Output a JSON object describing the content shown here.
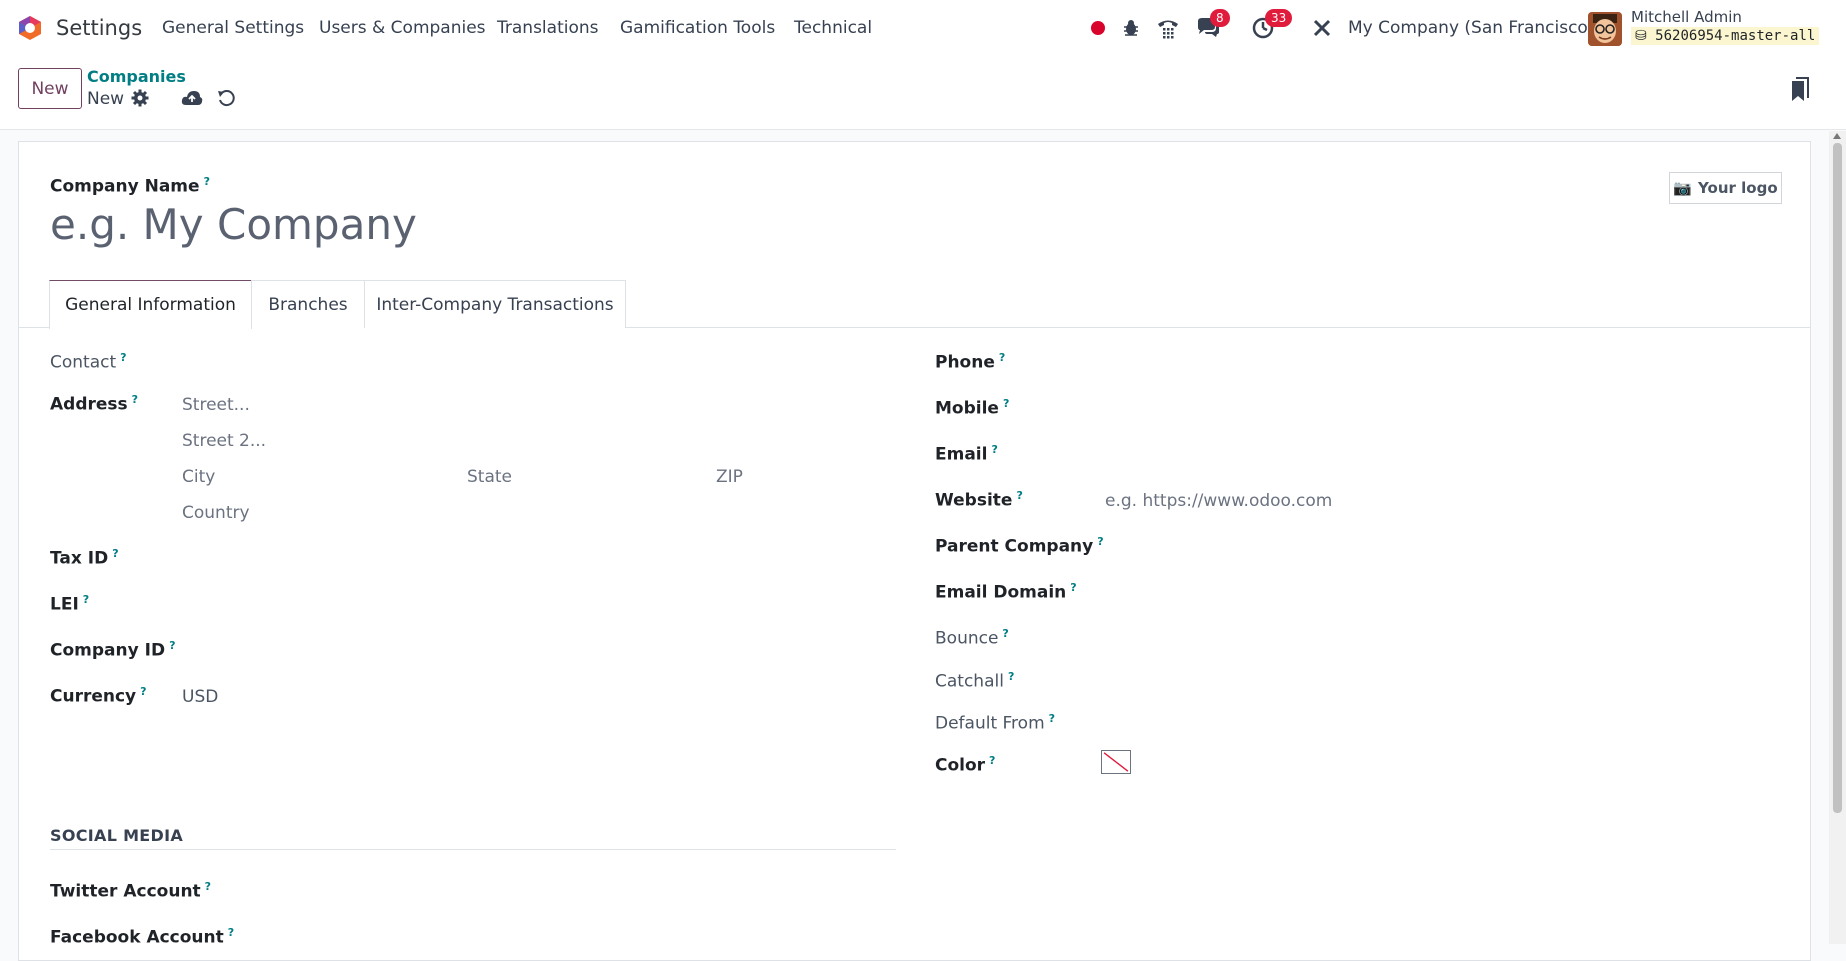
{
  "navbar": {
    "app_name": "Settings",
    "menus": [
      "General Settings",
      "Users & Companies",
      "Translations",
      "Gamification Tools",
      "Technical"
    ],
    "messages_count": "8",
    "activities_count": "33",
    "company": "My Company (San Francisco)",
    "user_name": "Mitchell Admin",
    "database": "56206954-master-all",
    "icons": [
      "record-dot-icon",
      "bug-icon",
      "phone-icon",
      "chat-icon",
      "clock-icon",
      "tools-icon"
    ]
  },
  "control": {
    "new_button": "New",
    "breadcrumb_parent": "Companies",
    "breadcrumb_current": "New"
  },
  "form": {
    "company_name_label": "Company Name",
    "company_name_placeholder": "e.g. My Company",
    "logo_button": "Your logo",
    "tabs": [
      "General Information",
      "Branches",
      "Inter-Company Transactions"
    ],
    "left": {
      "contact_label": "Contact",
      "address_label": "Address",
      "street_placeholder": "Street...",
      "street2_placeholder": "Street 2...",
      "city_placeholder": "City",
      "state_placeholder": "State",
      "zip_placeholder": "ZIP",
      "country_placeholder": "Country",
      "tax_id_label": "Tax ID",
      "lei_label": "LEI",
      "company_id_label": "Company ID",
      "currency_label": "Currency",
      "currency_value": "USD"
    },
    "right": {
      "phone_label": "Phone",
      "mobile_label": "Mobile",
      "email_label": "Email",
      "website_label": "Website",
      "website_placeholder": "e.g. https://www.odoo.com",
      "parent_company_label": "Parent Company",
      "email_domain_label": "Email Domain",
      "bounce_label": "Bounce",
      "catchall_label": "Catchall",
      "default_from_label": "Default From",
      "color_label": "Color"
    },
    "social": {
      "title": "SOCIAL MEDIA",
      "twitter_label": "Twitter Account",
      "facebook_label": "Facebook Account"
    },
    "help_mark": "?"
  },
  "colors": {
    "brand": "#714b67",
    "link": "#017e84",
    "badge": "#e01b3c",
    "record_dot": "#d9042b"
  }
}
